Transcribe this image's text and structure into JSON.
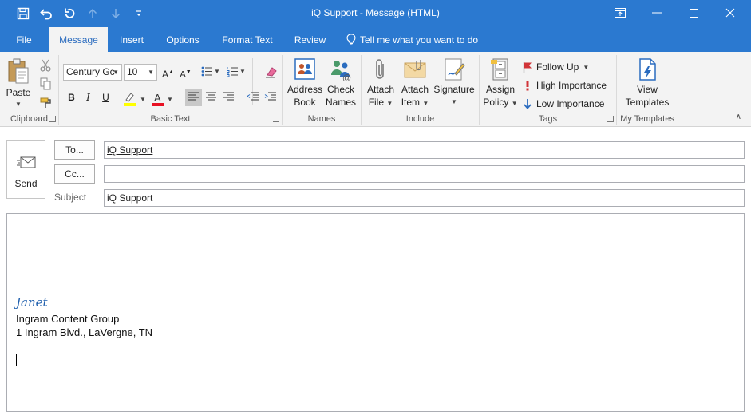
{
  "window": {
    "title": "iQ Support  -  Message (HTML)"
  },
  "tabs": {
    "file": "File",
    "message": "Message",
    "insert": "Insert",
    "options": "Options",
    "format_text": "Format Text",
    "review": "Review",
    "tell_me": "Tell me what you want to do"
  },
  "ribbon": {
    "clipboard": {
      "label": "Clipboard",
      "paste": "Paste"
    },
    "basic_text": {
      "label": "Basic Text",
      "font": "Century Gc",
      "size": "10",
      "bold": "B",
      "italic": "I",
      "underline": "U"
    },
    "names": {
      "label": "Names",
      "address_book_1": "Address",
      "address_book_2": "Book",
      "check_names_1": "Check",
      "check_names_2": "Names"
    },
    "include": {
      "label": "Include",
      "attach_file_1": "Attach",
      "attach_file_2": "File",
      "attach_item_1": "Attach",
      "attach_item_2": "Item",
      "signature": "Signature"
    },
    "tags": {
      "label": "Tags",
      "assign_policy_1": "Assign",
      "assign_policy_2": "Policy",
      "follow_up": "Follow Up",
      "high_importance": "High Importance",
      "low_importance": "Low Importance"
    },
    "my_templates": {
      "label": "My Templates",
      "view_1": "View",
      "view_2": "Templates"
    }
  },
  "compose": {
    "send_label": "Send",
    "to_button": "To...",
    "cc_button": "Cc...",
    "subject_label": "Subject",
    "to_value": "iQ Support",
    "cc_value": "",
    "subject_value": "iQ Support"
  },
  "body": {
    "signature_name": "Janet",
    "line1": "Ingram Content Group",
    "line2": "1 Ingram Blvd., LaVergne, TN"
  },
  "colors": {
    "title_bar": "#2b79d0",
    "ribbon_bg": "#f3f3f3",
    "signature_name": "#1f5fad",
    "highlight_yellow": "#ffff00",
    "font_color_red": "#e81123"
  },
  "icons": [
    "save-icon",
    "undo-icon",
    "redo-icon",
    "up-arrow-icon",
    "down-arrow-icon",
    "customize-icon",
    "restore-ribbon-icon",
    "minimize-icon",
    "maximize-icon",
    "close-icon",
    "lightbulb-icon",
    "paste-icon",
    "cut-icon",
    "copy-icon",
    "format-painter-icon",
    "bullets-icon",
    "numbering-icon",
    "clear-formatting-icon",
    "address-book-icon",
    "check-names-icon",
    "attach-file-icon",
    "attach-item-icon",
    "signature-icon",
    "assign-policy-icon",
    "flag-icon",
    "high-importance-icon",
    "low-importance-icon",
    "view-templates-icon",
    "send-icon"
  ]
}
